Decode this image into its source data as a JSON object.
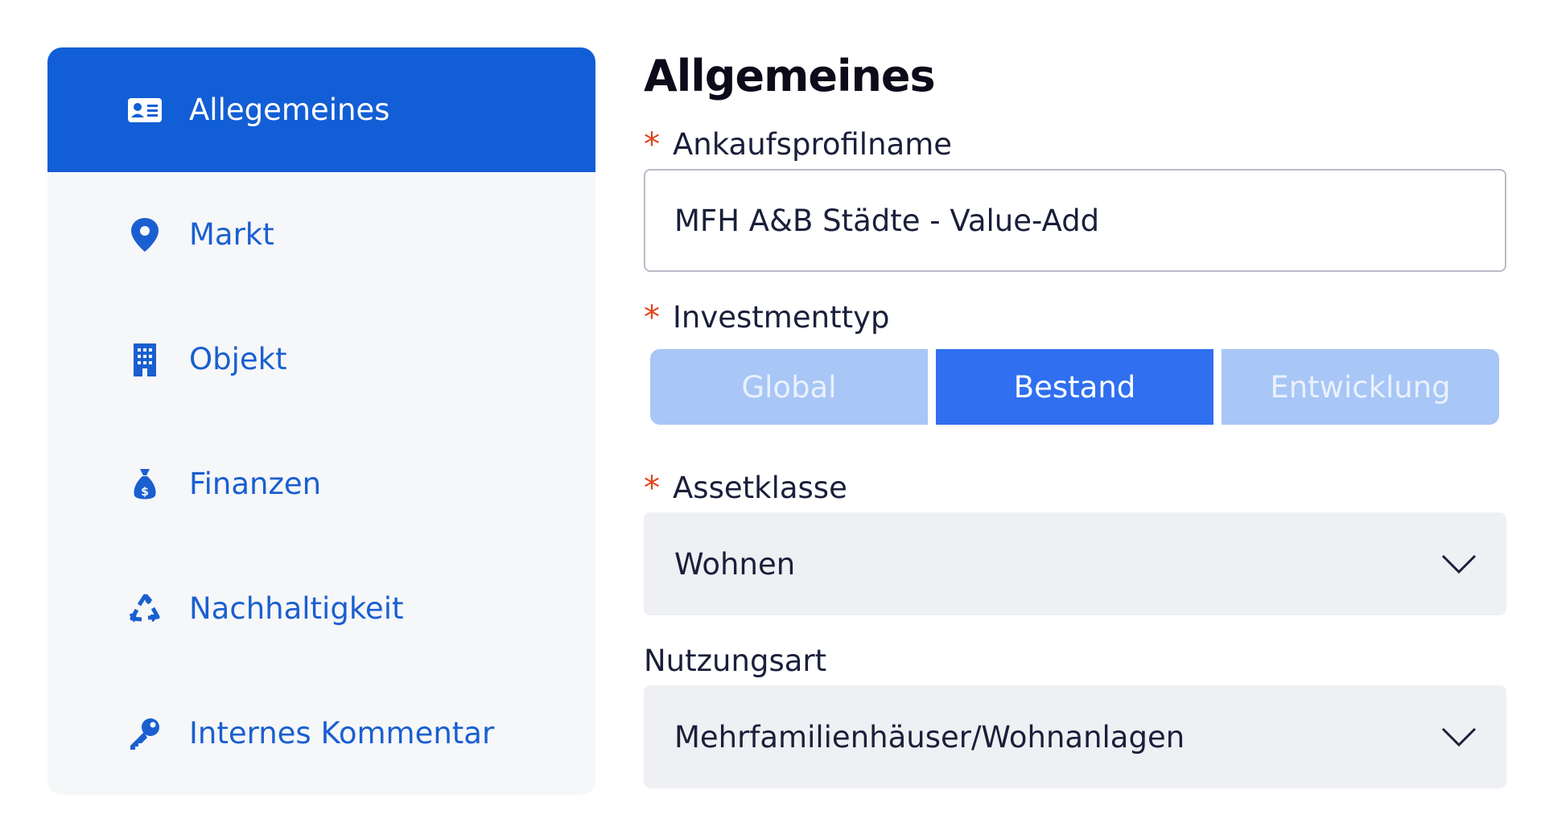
{
  "sidebar": {
    "items": [
      {
        "label": "Allegemeines",
        "icon": "id-card-icon",
        "active": true
      },
      {
        "label": "Markt",
        "icon": "map-pin-icon",
        "active": false
      },
      {
        "label": "Objekt",
        "icon": "building-icon",
        "active": false
      },
      {
        "label": "Finanzen",
        "icon": "money-bag-icon",
        "active": false
      },
      {
        "label": "Nachhaltigkeit",
        "icon": "recycle-icon",
        "active": false
      },
      {
        "label": "Internes Kommentar",
        "icon": "key-icon",
        "active": false
      }
    ]
  },
  "main": {
    "title": "Allgemeines",
    "profile_name": {
      "label": "Ankaufsprofilname",
      "required_mark": "*",
      "value": "MFH A&B Städte - Value-Add"
    },
    "investment_type": {
      "label": "Investmenttyp",
      "required_mark": "*",
      "options": [
        "Global",
        "Bestand",
        "Entwicklung"
      ],
      "selected": "Bestand"
    },
    "asset_class": {
      "label": "Assetklasse",
      "required_mark": "*",
      "value": "Wohnen"
    },
    "usage_type": {
      "label": "Nutzungsart",
      "value": "Mehrfamilienhäuser/Wohnanlagen"
    }
  },
  "colors": {
    "accent": "#125ed6",
    "segment_selected": "#2f6ff0",
    "segment_unselected": "#a8c6f6",
    "required": "#e2421c",
    "sidebar_bg": "#f6f7f9",
    "select_bg": "#eef0f3"
  }
}
